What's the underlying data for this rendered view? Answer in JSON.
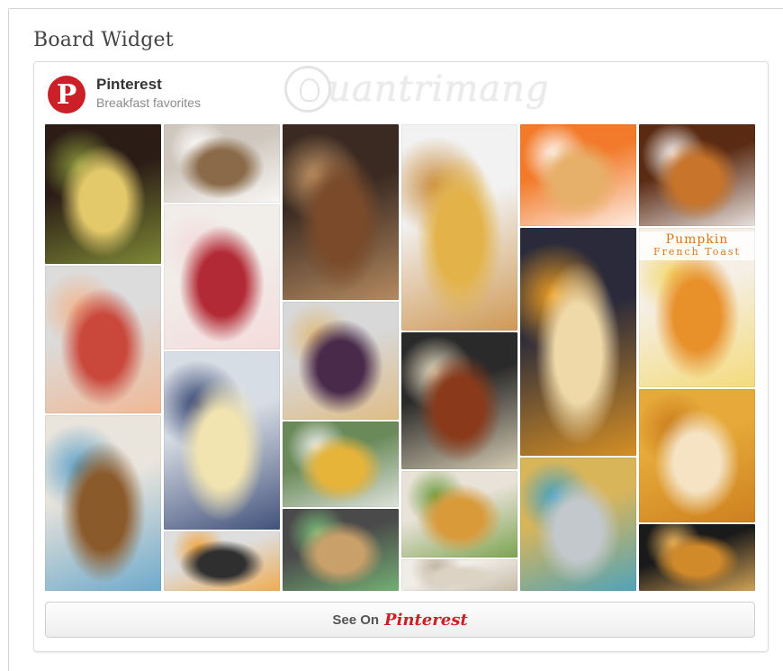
{
  "page": {
    "title": "Board Widget"
  },
  "widget": {
    "brand": "Pinterest",
    "board_name": "Breakfast favorites",
    "logo_letter": "P",
    "watermark": "uantrimang",
    "see_on_label": "See On",
    "see_on_brand": "Pinterest",
    "colors": {
      "brand_red": "#cb2027",
      "button_bg": "#f4f4f4"
    }
  },
  "pins": [
    {
      "name": "pin-frittata",
      "col": 0,
      "r": 0,
      "colors": [
        "#2b1c16",
        "#e3c96a",
        "#8a9a3b"
      ],
      "overlay": ""
    },
    {
      "name": "pin-fruit-plate",
      "col": 0,
      "r": 1,
      "colors": [
        "#dcdcdc",
        "#c9473b",
        "#f2b38a"
      ],
      "overlay": ""
    },
    {
      "name": "pin-bread-pudding",
      "col": 0,
      "r": 2,
      "colors": [
        "#e9e4dc",
        "#8b5a2b",
        "#5aa0c8"
      ],
      "overlay": ""
    },
    {
      "name": "pin-granola-bowl",
      "col": 1,
      "r": 0,
      "colors": [
        "#cfc7bd",
        "#8a6a48",
        "#ffffff"
      ],
      "overlay": ""
    },
    {
      "name": "pin-oatmeal-berries",
      "col": 1,
      "r": 1,
      "colors": [
        "#f1eeea",
        "#b22a35",
        "#f4d9d9"
      ],
      "overlay": ""
    },
    {
      "name": "pin-banana-berry-bake",
      "col": 1,
      "r": 2,
      "colors": [
        "#d7dde4",
        "#f2e4b0",
        "#2a3a6a"
      ],
      "overlay": ""
    },
    {
      "name": "pin-egg-pan",
      "col": 1,
      "r": 3,
      "colors": [
        "#dedede",
        "#2f2f2f",
        "#f2a33a"
      ],
      "overlay": ""
    },
    {
      "name": "pin-banana-bread",
      "col": 2,
      "r": 0,
      "colors": [
        "#3a2a22",
        "#7a4a2a",
        "#c99a6a"
      ],
      "overlay": ""
    },
    {
      "name": "pin-smoothie-bowl",
      "col": 2,
      "r": 1,
      "colors": [
        "#d8d8d8",
        "#4a2a4a",
        "#e0b878"
      ],
      "overlay": ""
    },
    {
      "name": "pin-brunch-spread",
      "col": 2,
      "r": 2,
      "colors": [
        "#6a8a5a",
        "#e7b43a",
        "#f2f2f2"
      ],
      "overlay": ""
    },
    {
      "name": "pin-pouring-syrup",
      "col": 2,
      "r": 3,
      "colors": [
        "#4a4a4a",
        "#c9a06a",
        "#7ac07a"
      ],
      "overlay": ""
    },
    {
      "name": "pin-egg-biscuits",
      "col": 3,
      "r": 0,
      "colors": [
        "#f2f2f2",
        "#e3b34a",
        "#c98a3a"
      ],
      "overlay": ""
    },
    {
      "name": "pin-skillet-eggs",
      "col": 3,
      "r": 1,
      "colors": [
        "#2a2a2a",
        "#8a3a1a",
        "#f2e6c9"
      ],
      "overlay": ""
    },
    {
      "name": "pin-egg-cups",
      "col": 3,
      "r": 2,
      "colors": [
        "#e9e2d8",
        "#d99a3a",
        "#6a9a3a"
      ],
      "overlay": ""
    },
    {
      "name": "pin-porridge",
      "col": 3,
      "r": 3,
      "colors": [
        "#f0ece6",
        "#dcd3c4",
        "#bfb3a0"
      ],
      "overlay": ""
    },
    {
      "name": "pin-pancakes",
      "col": 4,
      "r": 0,
      "colors": [
        "#f27a2a",
        "#e6b06a",
        "#ffffff"
      ],
      "overlay": ""
    },
    {
      "name": "pin-egg-in-biscuit",
      "col": 4,
      "r": 1,
      "colors": [
        "#2a2a3a",
        "#f0d9a8",
        "#f2a020"
      ],
      "overlay": ""
    },
    {
      "name": "pin-smoothie-jar",
      "col": 4,
      "r": 2,
      "colors": [
        "#d9b55a",
        "#c2c8cc",
        "#3aa0c8"
      ],
      "overlay": ""
    },
    {
      "name": "pin-french-toast-cream",
      "col": 5,
      "r": 0,
      "colors": [
        "#5a2a12",
        "#c8742a",
        "#ffffff"
      ],
      "overlay": ""
    },
    {
      "name": "pin-pumpkin-french-toast",
      "col": 5,
      "r": 1,
      "colors": [
        "#f5efe6",
        "#e8902a",
        "#f4d86a"
      ],
      "overlay": "Pumpkin\nFrench Toast"
    },
    {
      "name": "pin-baked-bread-dish",
      "col": 5,
      "r": 2,
      "colors": [
        "#e6a93a",
        "#f5e3c4",
        "#c97a1a"
      ],
      "overlay": ""
    },
    {
      "name": "pin-toasted-squares",
      "col": 5,
      "r": 3,
      "colors": [
        "#1a1a1a",
        "#d18a2a",
        "#f0b860"
      ],
      "overlay": ""
    }
  ]
}
